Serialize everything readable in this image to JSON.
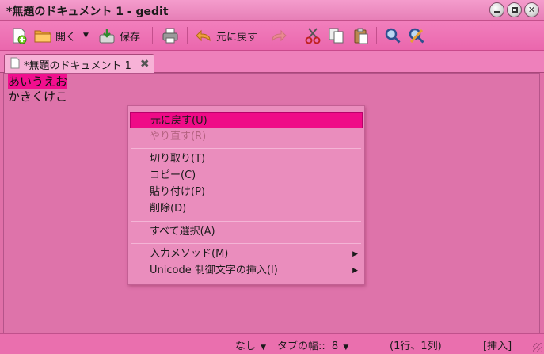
{
  "window": {
    "title": "*無題のドキュメント 1 - gedit"
  },
  "toolbar": {
    "open_label": "開く",
    "save_label": "保存",
    "undo_label": "元に戻す"
  },
  "tab": {
    "label": "*無題のドキュメント 1"
  },
  "editor": {
    "lines": [
      "あいうえお",
      "かきくけこ"
    ]
  },
  "context_menu": {
    "items": [
      "元に戻す(U)",
      "やり直す(R)",
      "切り取り(T)",
      "コピー(C)",
      "貼り付け(P)",
      "削除(D)",
      "すべて選択(A)",
      "入力メソッド(M)",
      "Unicode 制御文字の挿入(I)"
    ]
  },
  "statusbar": {
    "language": "なし",
    "tab_width_label": "タブの幅::",
    "tab_width_value": "8",
    "position": "(1行、1列)",
    "mode": "[挿入]"
  },
  "colors": {
    "accent": "#f10f8e",
    "window_bg": "#e070a8"
  }
}
